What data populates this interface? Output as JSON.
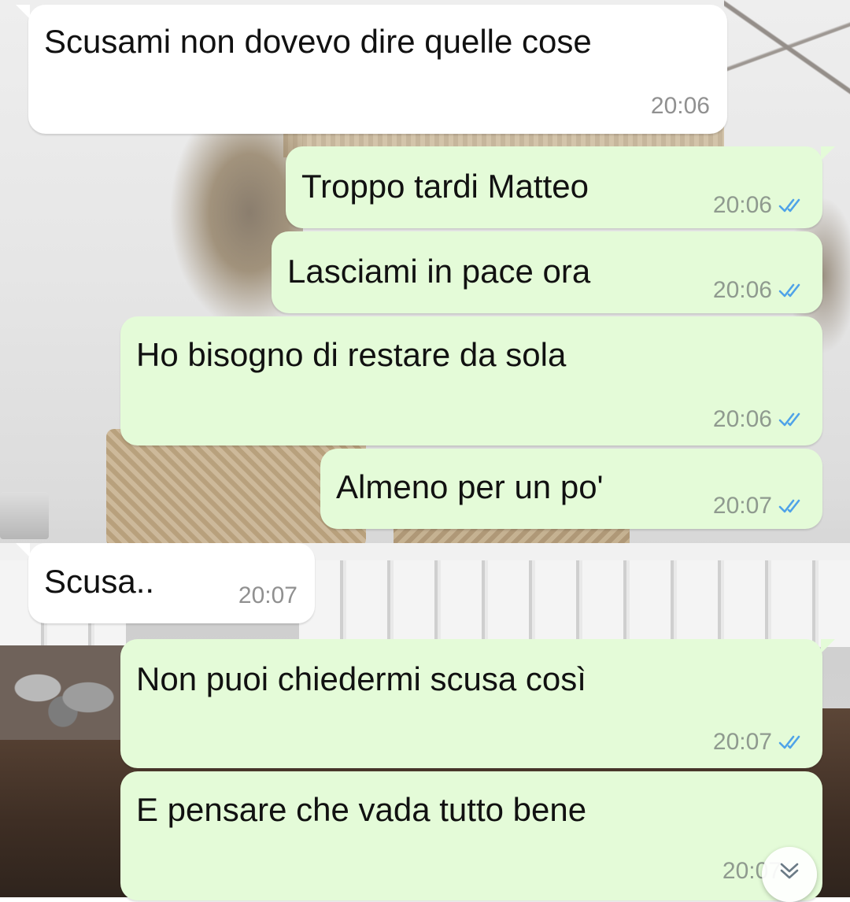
{
  "colors": {
    "incoming_bubble": "#ffffff",
    "outgoing_bubble": "#e4fbd8",
    "read_ticks": "#4fa3e8",
    "timestamp": "#8f9a8f"
  },
  "messages": [
    {
      "direction": "incoming",
      "text": "Scusami non dovevo dire quelle cose",
      "time": "20:06"
    },
    {
      "direction": "outgoing",
      "text": "Troppo tardi Matteo",
      "time": "20:06",
      "status": "read",
      "status_icon": "double-check-icon"
    },
    {
      "direction": "outgoing",
      "text": "Lasciami in pace ora",
      "time": "20:06",
      "status": "read",
      "status_icon": "double-check-icon"
    },
    {
      "direction": "outgoing",
      "text": "Ho bisogno di restare da sola",
      "time": "20:06",
      "status": "read",
      "status_icon": "double-check-icon"
    },
    {
      "direction": "outgoing",
      "text": "Almeno per un po'",
      "time": "20:07",
      "status": "read",
      "status_icon": "double-check-icon"
    },
    {
      "direction": "incoming",
      "text": "Scusa..",
      "time": "20:07"
    },
    {
      "direction": "outgoing",
      "text": "Non puoi chiedermi scusa così",
      "time": "20:07",
      "status": "read",
      "status_icon": "double-check-icon"
    },
    {
      "direction": "outgoing",
      "text": "E pensare che vada tutto bene",
      "time": "20:07",
      "status": "read",
      "status_icon": "double-check-icon"
    }
  ],
  "scroll_button": {
    "icon": "chevron-double-down-icon"
  }
}
